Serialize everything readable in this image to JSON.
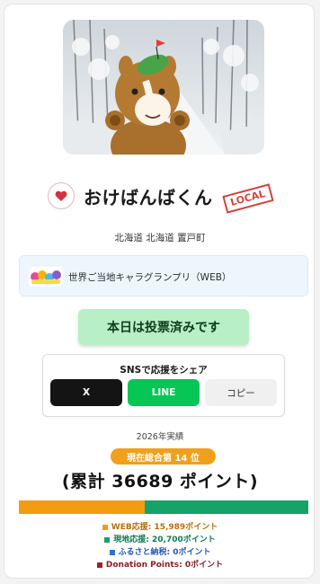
{
  "character": {
    "name": "おけばんばくん",
    "badge": "LOCAL",
    "location": "北海道 北海道 置戸町"
  },
  "grandprix": {
    "label": "世界ご当地キャラグランプリ（WEB）"
  },
  "vote_button": "本日は投票済みです",
  "share": {
    "title": "SNSで応援をシェア",
    "x_label": "X",
    "line_label": "LINE",
    "copy_label": "コピー"
  },
  "stats": {
    "year_label": "2026年実績",
    "rank_label": "現在総合第 14 位",
    "total_label": "(累計 36689 ポイント)"
  },
  "breakdown": [
    {
      "label": "WEB応援: 15,989ポイント",
      "value": 15989,
      "color": "#f39c12"
    },
    {
      "label": "現地応援: 20,700ポイント",
      "value": 20700,
      "color": "#16a36a"
    },
    {
      "label": "ふるさと納税: 0ポイント",
      "value": 0,
      "color": "#2f6fd6"
    },
    {
      "label": "Donation Points: 0ポイント",
      "value": 0,
      "color": "#a3202a"
    }
  ],
  "colors": {
    "vote_bg": "#b9efc6",
    "rank_bg": "#f0a01c",
    "line_green": "#06c755"
  },
  "icons": {
    "favorite": "heart-icon",
    "grandprix": "grandprix-logo-icon"
  }
}
